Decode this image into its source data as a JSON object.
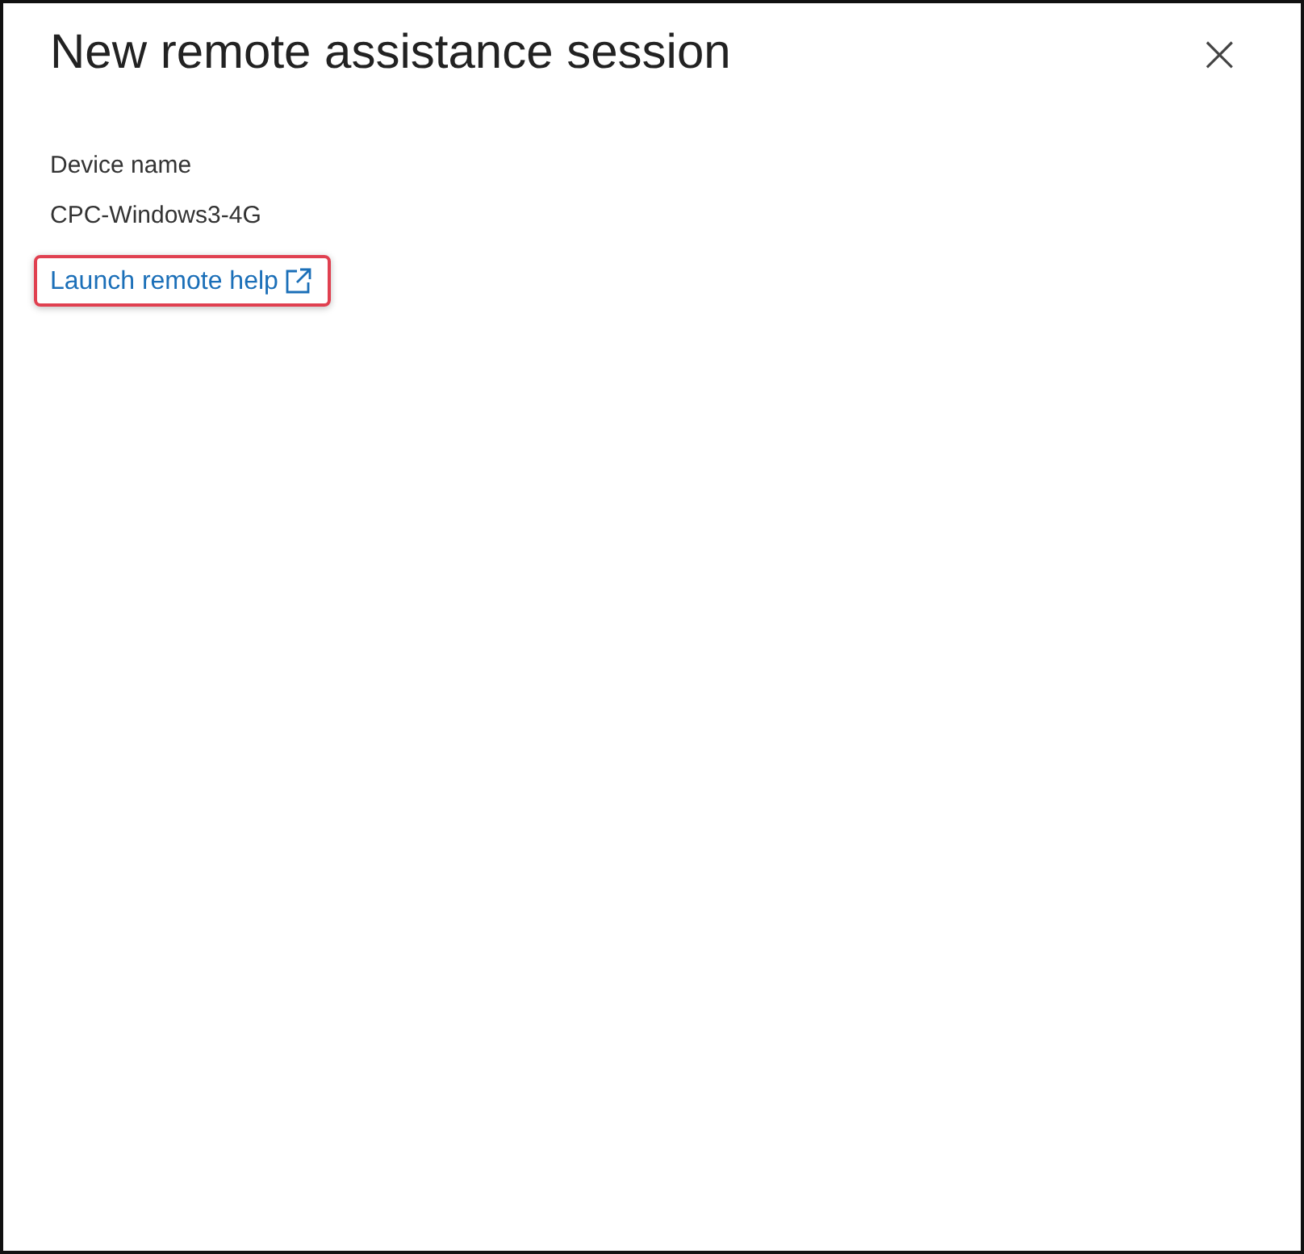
{
  "dialog": {
    "title": "New remote assistance session",
    "close": "×"
  },
  "field": {
    "label": "Device name",
    "value": "CPC-Windows3-4G"
  },
  "link": {
    "label": "Launch remote help",
    "highlighted": true
  }
}
